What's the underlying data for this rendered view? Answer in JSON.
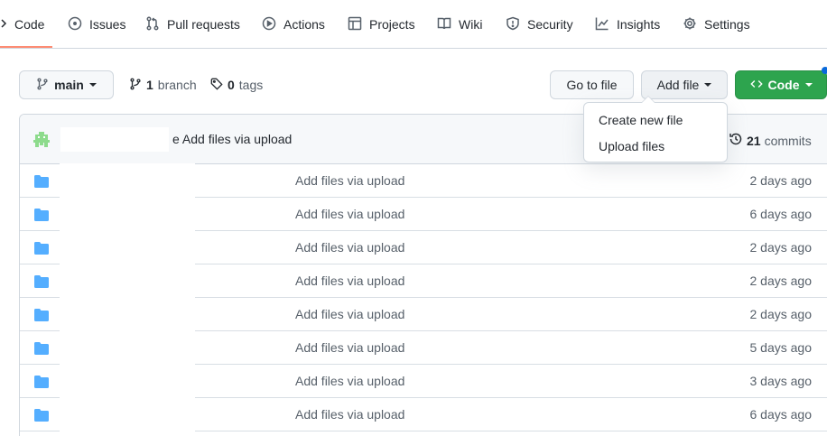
{
  "nav": {
    "items": [
      {
        "label": "Code",
        "icon": "code-icon"
      },
      {
        "label": "Issues",
        "icon": "issue-opened-icon"
      },
      {
        "label": "Pull requests",
        "icon": "git-pull-request-icon"
      },
      {
        "label": "Actions",
        "icon": "play-icon"
      },
      {
        "label": "Projects",
        "icon": "table-icon"
      },
      {
        "label": "Wiki",
        "icon": "book-icon"
      },
      {
        "label": "Security",
        "icon": "shield-icon"
      },
      {
        "label": "Insights",
        "icon": "graph-icon"
      },
      {
        "label": "Settings",
        "icon": "gear-icon"
      }
    ],
    "active_index": 0,
    "active_color": "#fd8c73"
  },
  "branch_bar": {
    "branch_name": "main",
    "branch_count": "1",
    "branch_label": "branch",
    "tag_count": "0",
    "tag_label": "tags",
    "go_to_file": "Go to file",
    "add_file": "Add file",
    "code_button": "Code"
  },
  "add_file_menu": {
    "items": [
      "Create new file",
      "Upload files"
    ]
  },
  "latest_commit": {
    "message": "e Add files via upload",
    "commits_count": "21",
    "commits_label": "commits"
  },
  "files": [
    {
      "message": "Add files via upload",
      "age": "2 days ago"
    },
    {
      "message": "Add files via upload",
      "age": "6 days ago"
    },
    {
      "message": "Add files via upload",
      "age": "2 days ago"
    },
    {
      "message": "Add files via upload",
      "age": "2 days ago"
    },
    {
      "message": "Add files via upload",
      "age": "2 days ago"
    },
    {
      "message": "Add files via upload",
      "age": "5 days ago"
    },
    {
      "message": "Add files via upload",
      "age": "3 days ago"
    },
    {
      "message": "Add files via upload",
      "age": "6 days ago"
    }
  ],
  "colors": {
    "accent_green": "#2da44e",
    "folder_blue": "#54aeff",
    "border": "#d0d7de"
  }
}
